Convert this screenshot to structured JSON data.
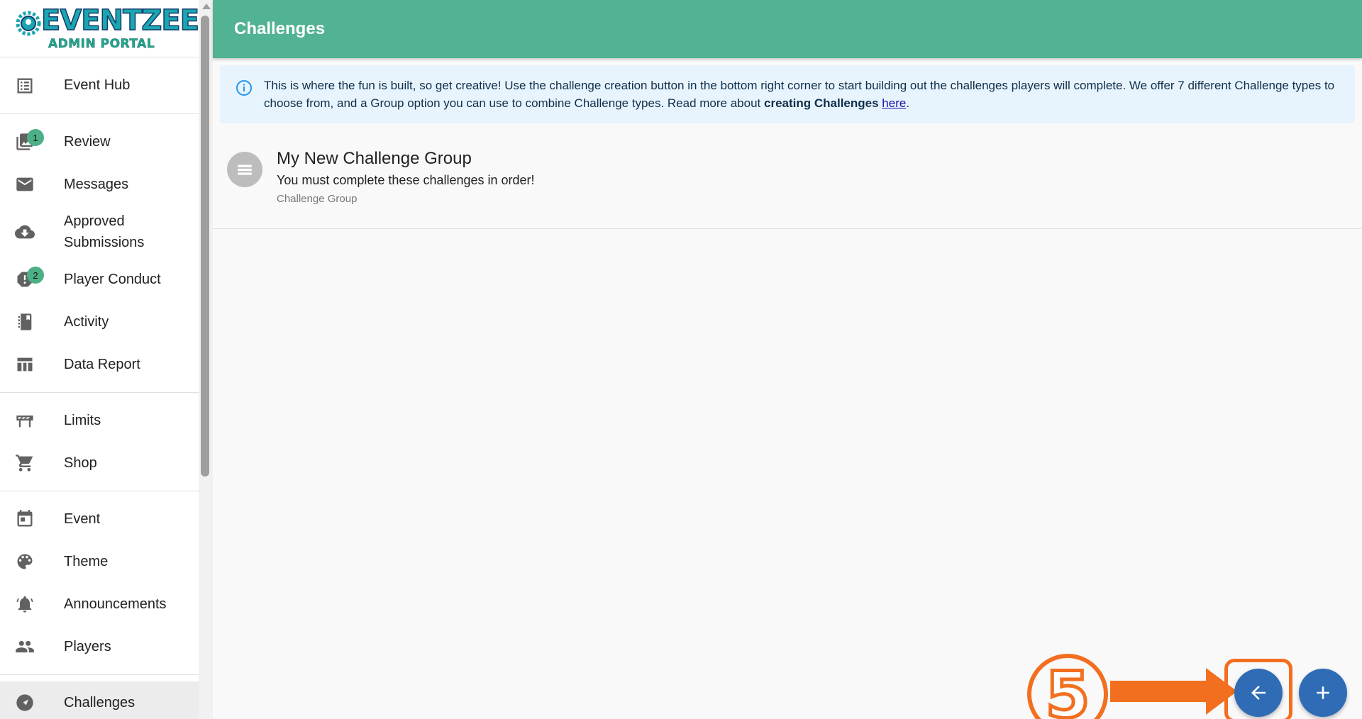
{
  "logo": {
    "name": "EVENTZEE",
    "subtitle": "ADMIN PORTAL"
  },
  "sidebar": {
    "items": [
      {
        "label": "Event Hub",
        "icon": "list-icon"
      },
      {
        "label": "Review",
        "icon": "photo-library-icon",
        "badge": "1"
      },
      {
        "label": "Messages",
        "icon": "mail-icon"
      },
      {
        "label": "Approved Submissions",
        "icon": "cloud-download-icon"
      },
      {
        "label": "Player Conduct",
        "icon": "report-icon",
        "badge": "2"
      },
      {
        "label": "Activity",
        "icon": "activity-book-icon"
      },
      {
        "label": "Data Report",
        "icon": "table-icon"
      },
      {
        "label": "Limits",
        "icon": "roadblock-icon"
      },
      {
        "label": "Shop",
        "icon": "cart-icon"
      },
      {
        "label": "Event",
        "icon": "calendar-icon"
      },
      {
        "label": "Theme",
        "icon": "palette-icon"
      },
      {
        "label": "Announcements",
        "icon": "alarm-bell-icon"
      },
      {
        "label": "Players",
        "icon": "people-icon"
      },
      {
        "label": "Challenges",
        "icon": "challenges-icon"
      }
    ]
  },
  "header": {
    "title": "Challenges"
  },
  "info": {
    "text_before": "This is where the fun is built, so get creative! Use the challenge creation button in the bottom right corner to start building out the challenges players will complete. We offer 7 different Challenge types to choose from, and a Group option you can use to combine Challenge types. Read more about ",
    "bold": "creating Challenges",
    "space": " ",
    "link": "here",
    "text_after": "."
  },
  "groups": [
    {
      "title": "My New Challenge Group",
      "description": "You must complete these challenges in order!",
      "type": "Challenge Group"
    }
  ],
  "annotation": {
    "step": "5",
    "color": "#f36f20"
  },
  "colors": {
    "header": "#52b294",
    "fab": "#2f6cb5",
    "badge": "#4caf86",
    "info_bg": "#e8f4fd"
  }
}
